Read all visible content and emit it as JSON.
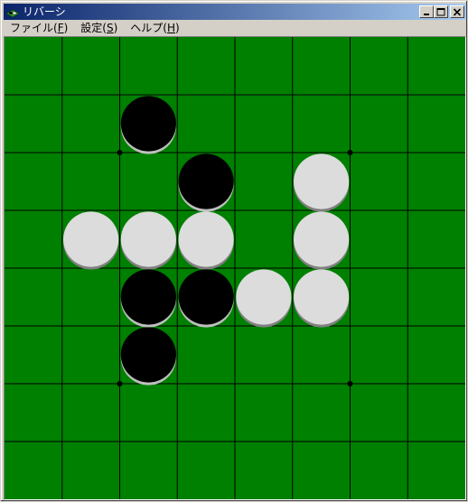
{
  "window": {
    "title": "リバーシ",
    "icon": "reversi-app-icon",
    "buttons": [
      "minimize-icon",
      "maximize-icon",
      "close-icon"
    ]
  },
  "menu": [
    {
      "label": "ファイル(",
      "accel": "F",
      "suffix": ")"
    },
    {
      "label": "設定(",
      "accel": "S",
      "suffix": ")"
    },
    {
      "label": "ヘルプ(",
      "accel": "H",
      "suffix": ")"
    }
  ],
  "board": {
    "size": 8,
    "colors": {
      "felt": "#008000",
      "line": "#000000",
      "black": "#000000",
      "white": "#dcdcdc",
      "white_shadow": "#808080"
    },
    "cells": [
      [
        ".",
        ".",
        ".",
        ".",
        ".",
        ".",
        ".",
        "."
      ],
      [
        ".",
        ".",
        "B",
        ".",
        ".",
        ".",
        ".",
        "."
      ],
      [
        ".",
        ".",
        ".",
        "B",
        ".",
        "W",
        ".",
        "."
      ],
      [
        ".",
        "W",
        "W",
        "W",
        ".",
        "W",
        ".",
        "."
      ],
      [
        ".",
        ".",
        "B",
        "B",
        "W",
        "W",
        ".",
        "."
      ],
      [
        ".",
        ".",
        "B",
        ".",
        ".",
        ".",
        ".",
        "."
      ],
      [
        ".",
        ".",
        ".",
        ".",
        ".",
        ".",
        ".",
        "."
      ],
      [
        ".",
        ".",
        ".",
        ".",
        ".",
        ".",
        ".",
        "."
      ]
    ]
  }
}
